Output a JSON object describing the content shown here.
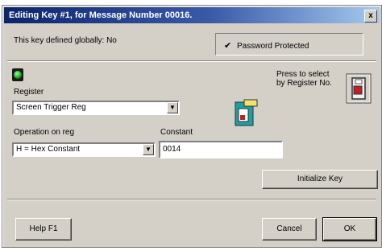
{
  "window": {
    "title": "Editing Key #1, for Message Number 00016.",
    "close_glyph": "x"
  },
  "global": {
    "text": "This key defined globally:  No"
  },
  "password": {
    "checked_mark": "✔",
    "label": "Password Protected"
  },
  "press_select": {
    "line1": "Press to select",
    "line2": "by Register No."
  },
  "register": {
    "label": "Register",
    "value": "Screen Trigger Reg"
  },
  "operation": {
    "label": "Operation on reg",
    "value": "H = Hex Constant"
  },
  "constant": {
    "label": "Constant",
    "value": "0014"
  },
  "buttons": {
    "initialize": "Initialize Key",
    "help": "Help  F1",
    "cancel": "Cancel",
    "ok": "OK"
  },
  "icons": {
    "led": "status-led-green",
    "register": "register-icon",
    "selector": "register-select-icon",
    "dropdown": "chevron-down-icon"
  },
  "colors": {
    "titlebar_start": "#0a246a",
    "titlebar_end": "#a6caf0",
    "face": "#d4d0c8"
  }
}
